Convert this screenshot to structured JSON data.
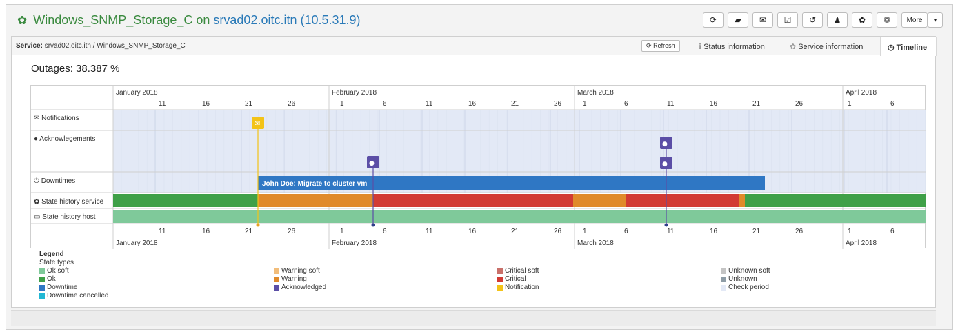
{
  "header": {
    "title_prefix": "Windows_SNMP_Storage_C on",
    "title_link": "srvad02.oitc.itn (10.5.31.9)",
    "more_label": "More"
  },
  "toolbar": {
    "icons": [
      "refresh-icon",
      "book-icon",
      "envelope-icon",
      "check-square-icon",
      "history-icon",
      "user-icon",
      "gear-icon",
      "gears-icon"
    ]
  },
  "panel": {
    "service_label": "Service:",
    "service_path": "srvad02.oitc.itn / Windows_SNMP_Storage_C",
    "refresh_label": "Refresh",
    "tabs": [
      {
        "label": "Status information",
        "icon": "info-icon"
      },
      {
        "label": "Service information",
        "icon": "gear-icon"
      },
      {
        "label": "Timeline",
        "icon": "clock-icon"
      }
    ]
  },
  "outages": "Outages: 38.387 %",
  "timeline": {
    "months": [
      "January 2018",
      "February 2018",
      "March 2018",
      "April 2018"
    ],
    "days": [
      "11",
      "16",
      "21",
      "26",
      "1",
      "6",
      "11",
      "16",
      "21",
      "26",
      "1",
      "6",
      "11",
      "16",
      "21",
      "26",
      "1",
      "6"
    ],
    "rows": [
      {
        "label": "Notifications",
        "icon": "envelope-icon"
      },
      {
        "label": "Acknowlegements",
        "icon": "comment-icon"
      },
      {
        "label": "Downtimes",
        "icon": "power-icon"
      },
      {
        "label": "State history service",
        "icon": "gear-icon"
      },
      {
        "label": "State history host",
        "icon": "desktop-icon"
      }
    ],
    "downtime_text": "John Doe: Migrate to cluster vm"
  },
  "legend": {
    "title": "Legend",
    "subtitle": "State types",
    "items": [
      {
        "label": "Ok soft",
        "color": "#7fc99a"
      },
      {
        "label": "Ok",
        "color": "#3fa048"
      },
      {
        "label": "Downtime",
        "color": "#2f77c4"
      },
      {
        "label": "Downtime cancelled",
        "color": "#22b8d4"
      },
      {
        "label": "Warning soft",
        "color": "#f2bd7a"
      },
      {
        "label": "Warning",
        "color": "#e08a2a"
      },
      {
        "label": "Acknowledged",
        "color": "#5b4ea6"
      },
      {
        "label": "Critical soft",
        "color": "#c9706a"
      },
      {
        "label": "Critical",
        "color": "#d23a33"
      },
      {
        "label": "Notification",
        "color": "#f3c318"
      },
      {
        "label": "Unknown soft",
        "color": "#c4c4c4"
      },
      {
        "label": "Unknown",
        "color": "#8e9ca6"
      },
      {
        "label": "Check period",
        "color": "#e3e9f6"
      }
    ]
  }
}
